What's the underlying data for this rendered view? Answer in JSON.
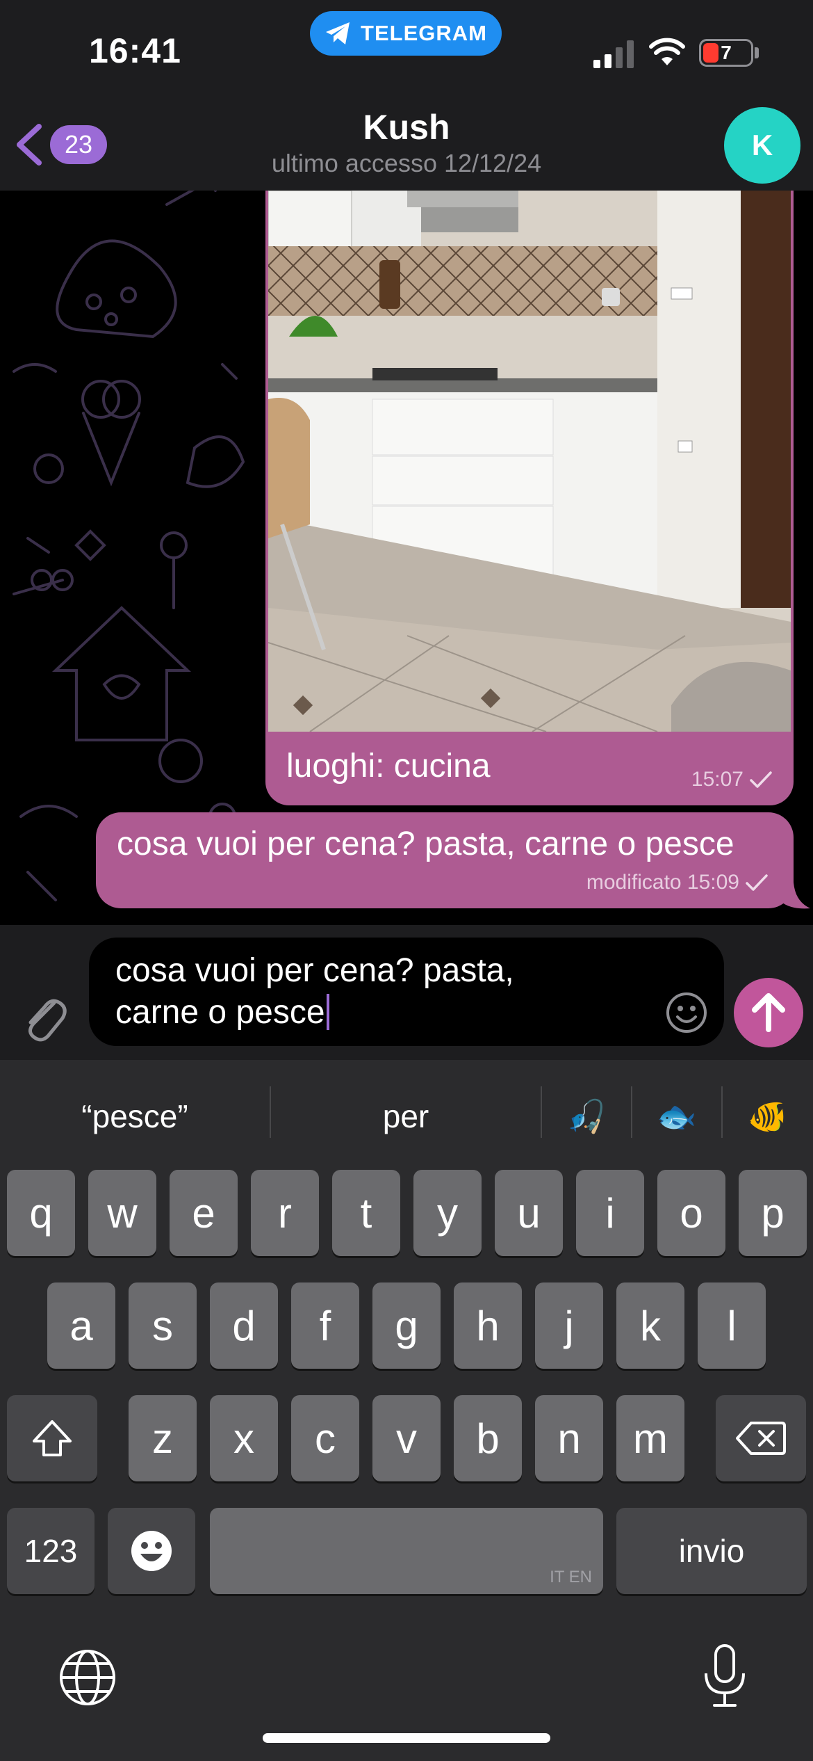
{
  "status_bar": {
    "time": "16:41",
    "app_pill": "TELEGRAM",
    "battery": "7"
  },
  "header": {
    "back_count": "23",
    "title": "Kush",
    "subtitle": "ultimo accesso 12/12/24",
    "avatar_letter": "K"
  },
  "messages": [
    {
      "type": "photo",
      "caption": "luoghi: cucina",
      "time": "15:07",
      "status": "check-icon"
    },
    {
      "type": "text",
      "text": "cosa vuoi per cena? pasta, carne o pesce",
      "time": "modificato 15:09",
      "status": "check-icon"
    }
  ],
  "composer": {
    "text_line1": "cosa vuoi per cena? pasta,",
    "text_line2": "carne o pesce"
  },
  "keyboard": {
    "suggestions": [
      "“pesce”",
      "per"
    ],
    "suggestion_emojis": [
      "🎣",
      "🐟",
      "🐠"
    ],
    "row1": [
      "q",
      "w",
      "e",
      "r",
      "t",
      "y",
      "u",
      "i",
      "o",
      "p"
    ],
    "row2": [
      "a",
      "s",
      "d",
      "f",
      "g",
      "h",
      "j",
      "k",
      "l"
    ],
    "row3": [
      "z",
      "x",
      "c",
      "v",
      "b",
      "n",
      "m"
    ],
    "numbers_label": "123",
    "space_lang": "IT EN",
    "return_label": "invio"
  },
  "colors": {
    "bubble": "#ae5b92",
    "send": "#c1569b",
    "accent": "#9b6bd6",
    "avatar": "#25d3c5"
  }
}
